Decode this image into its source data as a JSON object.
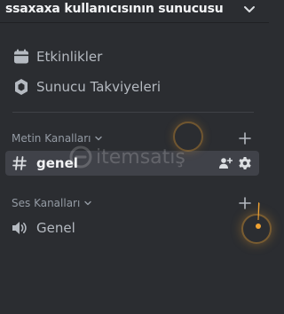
{
  "server": {
    "name": "ssaxaxa kullanıcısının sunucusu"
  },
  "menu": {
    "events_label": "Etkinlikler",
    "boosts_label": "Sunucu Takviyeleri"
  },
  "categories": {
    "text": {
      "title": "Metin Kanalları"
    },
    "voice": {
      "title": "Ses Kanalları"
    }
  },
  "channels": {
    "text": [
      {
        "name": "genel",
        "selected": true
      }
    ],
    "voice": [
      {
        "name": "Genel"
      }
    ]
  },
  "watermark": {
    "text": "itemsatış"
  },
  "colors": {
    "background": "#2b2d31",
    "selected_row": "#404249",
    "muted_text": "#949ba4",
    "indicator": "#f0a232"
  },
  "icons": {
    "header": "chevron-down-icon",
    "events": "calendar-icon",
    "boosts": "boost-gem-icon",
    "text_channel": "hashtag-icon",
    "voice_channel": "speaker-icon",
    "invite": "add-member-icon",
    "settings": "gear-icon",
    "add": "plus-icon"
  }
}
